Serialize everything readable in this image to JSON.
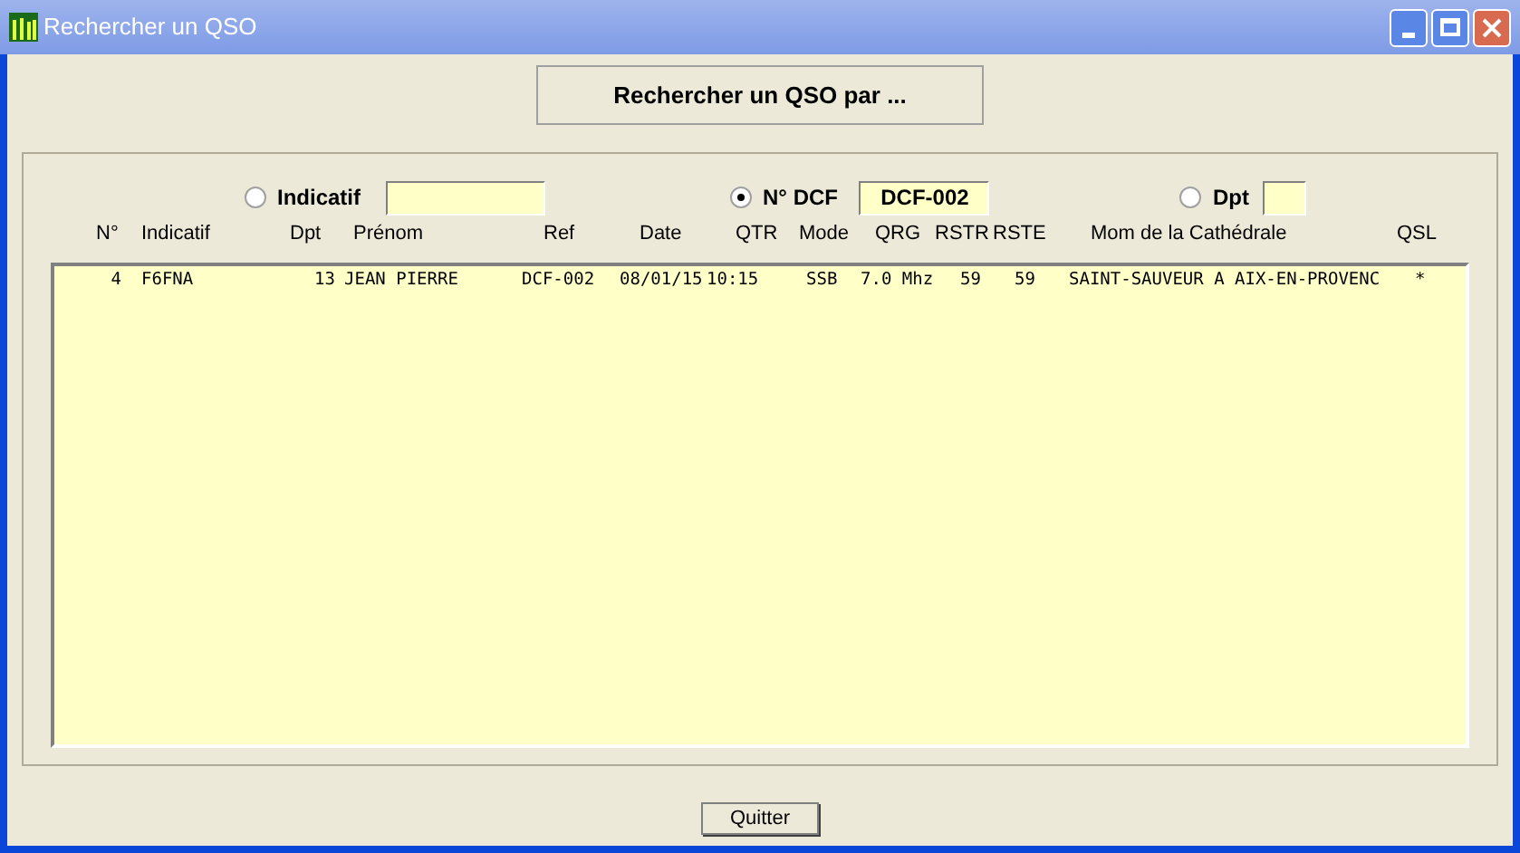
{
  "window": {
    "title": "Rechercher un QSO"
  },
  "search_button": "Rechercher un QSO par ...",
  "filters": [
    {
      "label": "Indicatif",
      "selected": false
    },
    {
      "label": "N° DCF",
      "selected": true,
      "value": "DCF-002"
    },
    {
      "label": "Dpt",
      "selected": false
    }
  ],
  "table": {
    "columns": [
      "N°",
      "Indicatif",
      "Dpt",
      "Prénom",
      "Ref",
      "Date",
      "QTR",
      "Mode",
      "QRG",
      "RSTR",
      "RSTE",
      "Mom de la Cathédrale",
      "QSL"
    ],
    "rows": [
      [
        "4",
        "F6FNA",
        "13",
        "JEAN PIERRE",
        "DCF-002",
        "08/01/15",
        "10:15",
        "SSB",
        "7.0 Mhz",
        "59",
        "59",
        "SAINT-SAUVEUR A AIX-EN-PROVENC",
        "*"
      ]
    ]
  },
  "buttons": [
    "Quitter"
  ]
}
